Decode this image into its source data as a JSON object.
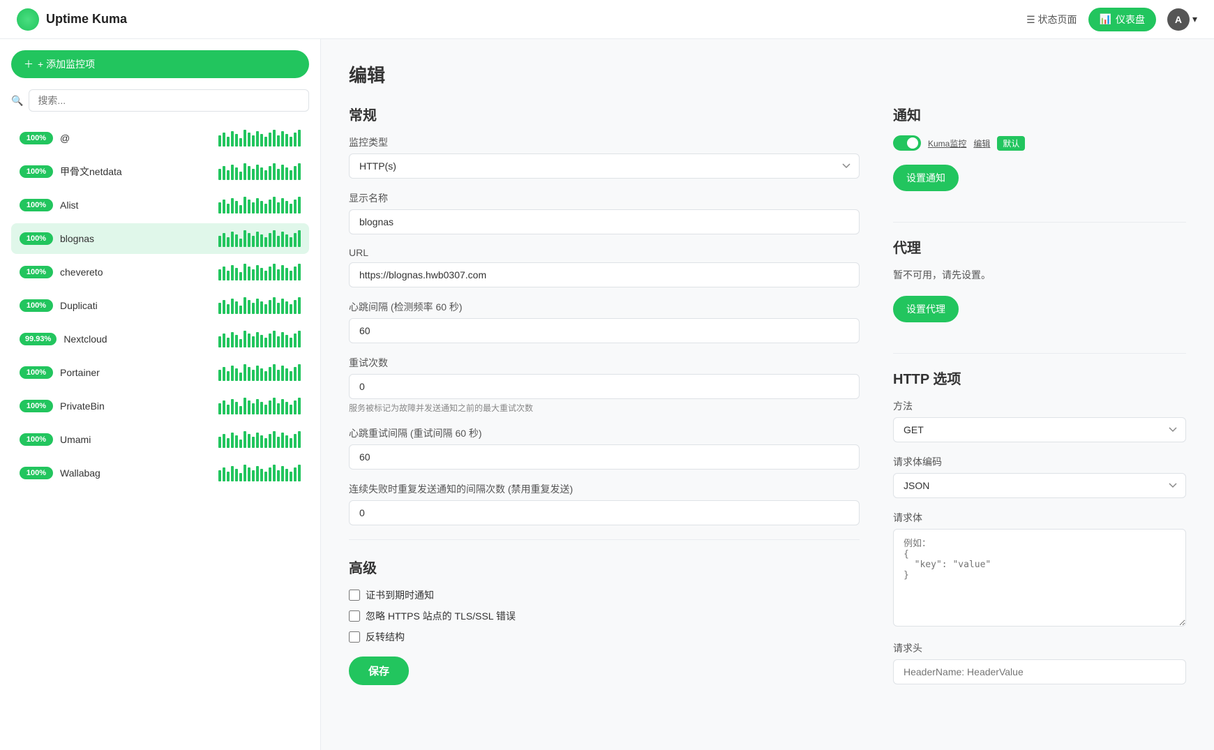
{
  "app": {
    "title": "Uptime Kuma",
    "nav_status": "状态页面",
    "nav_dashboard": "仪表盘",
    "avatar_char": "A"
  },
  "sidebar": {
    "add_button": "+ 添加监控项",
    "search_placeholder": "搜索...",
    "monitors": [
      {
        "name": "@",
        "badge": "100%",
        "active": false
      },
      {
        "name": "甲骨文netdata",
        "badge": "100%",
        "active": false
      },
      {
        "name": "Alist",
        "badge": "100%",
        "active": false
      },
      {
        "name": "blognas",
        "badge": "100%",
        "active": true
      },
      {
        "name": "chevereto",
        "badge": "100%",
        "active": false
      },
      {
        "name": "Duplicati",
        "badge": "100%",
        "active": false
      },
      {
        "name": "Nextcloud",
        "badge": "99.93%",
        "active": false
      },
      {
        "name": "Portainer",
        "badge": "100%",
        "active": false
      },
      {
        "name": "PrivateBin",
        "badge": "100%",
        "active": false
      },
      {
        "name": "Umami",
        "badge": "100%",
        "active": false
      },
      {
        "name": "Wallabag",
        "badge": "100%",
        "active": false
      }
    ]
  },
  "main": {
    "page_title": "编辑",
    "general_section": "常规",
    "monitor_type_label": "监控类型",
    "monitor_type_value": "HTTP(s)",
    "display_name_label": "显示名称",
    "display_name_value": "blognas",
    "url_label": "URL",
    "url_value": "https://blognas.hwb0307.com",
    "heartbeat_interval_label": "心跳间隔 (检测频率 60 秒)",
    "heartbeat_interval_value": "60",
    "retry_count_label": "重试次数",
    "retry_count_value": "0",
    "retry_hint": "服务被标记为故障并发送通知之前的最大重试次数",
    "heartbeat_retry_label": "心跳重试间隔 (重试间隔 60 秒)",
    "heartbeat_retry_value": "60",
    "resend_interval_label": "连续失败时重复发送通知的间隔次数 (禁用重复发送)",
    "resend_interval_value": "0",
    "advanced_section": "高级",
    "cert_notify_label": "证书到期时通知",
    "ignore_tls_label": "忽略 HTTPS 站点的 TLS/SSL 错误",
    "upside_down_label": "反转结构",
    "save_button": "保存"
  },
  "right_panel": {
    "notify_section": "通知",
    "notify_monitor": "Kuma监控",
    "notify_edit": "编辑",
    "notify_default": "默认",
    "setup_notify_btn": "设置通知",
    "proxy_section": "代理",
    "proxy_note": "暂不可用，请先设置。",
    "setup_proxy_btn": "设置代理",
    "http_section": "HTTP 选项",
    "method_label": "方法",
    "method_value": "GET",
    "body_encoding_label": "请求体编码",
    "body_encoding_value": "JSON",
    "body_label": "请求体",
    "body_placeholder": "例如：\n{\n  \"key\": \"value\"\n}",
    "headers_label": "请求头",
    "headers_placeholder": "HeaderName: HeaderValue"
  }
}
